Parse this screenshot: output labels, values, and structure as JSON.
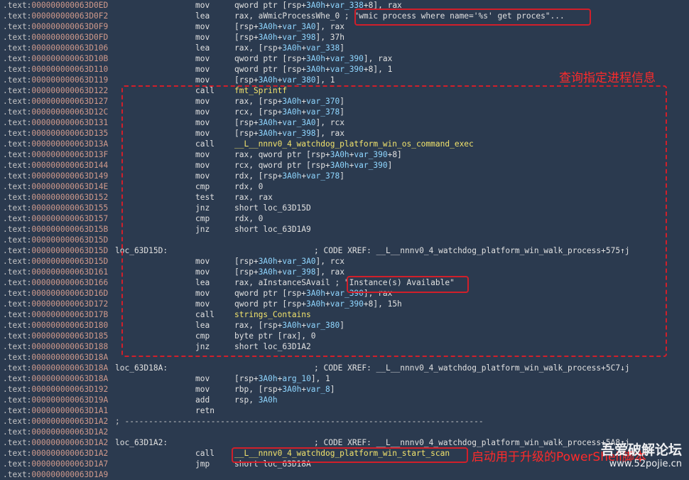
{
  "segment": ".text:",
  "rows": [
    {
      "addr": "000000000063D0ED",
      "label": "",
      "mnem": "mov",
      "ops": "qword ptr [rsp+3A0h+var_338+8], rax"
    },
    {
      "addr": "000000000063D0F2",
      "label": "",
      "mnem": "lea",
      "ops": "rax, aWmicProcessWhe_0 ; \"wmic process where name='%s' get proces\"..."
    },
    {
      "addr": "000000000063D0F9",
      "label": "",
      "mnem": "mov",
      "ops": "[rsp+3A0h+var_3A0], rax"
    },
    {
      "addr": "000000000063D0FD",
      "label": "",
      "mnem": "mov",
      "ops": "[rsp+3A0h+var_398], 37h"
    },
    {
      "addr": "000000000063D106",
      "label": "",
      "mnem": "lea",
      "ops": "rax, [rsp+3A0h+var_338]"
    },
    {
      "addr": "000000000063D10B",
      "label": "",
      "mnem": "mov",
      "ops": "qword ptr [rsp+3A0h+var_390], rax"
    },
    {
      "addr": "000000000063D110",
      "label": "",
      "mnem": "mov",
      "ops": "qword ptr [rsp+3A0h+var_390+8], 1"
    },
    {
      "addr": "000000000063D119",
      "label": "",
      "mnem": "mov",
      "ops": "[rsp+3A0h+var_380], 1"
    },
    {
      "addr": "000000000063D122",
      "label": "",
      "mnem": "call",
      "ops": "fmt_Sprintf",
      "call": true
    },
    {
      "addr": "000000000063D127",
      "label": "",
      "mnem": "mov",
      "ops": "rax, [rsp+3A0h+var_370]"
    },
    {
      "addr": "000000000063D12C",
      "label": "",
      "mnem": "mov",
      "ops": "rcx, [rsp+3A0h+var_378]"
    },
    {
      "addr": "000000000063D131",
      "label": "",
      "mnem": "mov",
      "ops": "[rsp+3A0h+var_3A0], rcx"
    },
    {
      "addr": "000000000063D135",
      "label": "",
      "mnem": "mov",
      "ops": "[rsp+3A0h+var_398], rax"
    },
    {
      "addr": "000000000063D13A",
      "label": "",
      "mnem": "call",
      "ops": "__L__nnnv0_4_watchdog_platform_win_os_command_exec",
      "call": true
    },
    {
      "addr": "000000000063D13F",
      "label": "",
      "mnem": "mov",
      "ops": "rax, qword ptr [rsp+3A0h+var_390+8]"
    },
    {
      "addr": "000000000063D144",
      "label": "",
      "mnem": "mov",
      "ops": "rcx, qword ptr [rsp+3A0h+var_390]"
    },
    {
      "addr": "000000000063D149",
      "label": "",
      "mnem": "mov",
      "ops": "rdx, [rsp+3A0h+var_378]"
    },
    {
      "addr": "000000000063D14E",
      "label": "",
      "mnem": "cmp",
      "ops": "rdx, 0"
    },
    {
      "addr": "000000000063D152",
      "label": "",
      "mnem": "test",
      "ops": "rax, rax"
    },
    {
      "addr": "000000000063D155",
      "label": "",
      "mnem": "jnz",
      "ops": "short loc_63D15D"
    },
    {
      "addr": "000000000063D157",
      "label": "",
      "mnem": "cmp",
      "ops": "rdx, 0"
    },
    {
      "addr": "000000000063D15B",
      "label": "",
      "mnem": "jnz",
      "ops": "short loc_63D1A9"
    },
    {
      "addr": "000000000063D15D",
      "label": "",
      "mnem": "",
      "ops": ""
    },
    {
      "addr": "000000000063D15D",
      "label": "loc_63D15D:",
      "mnem": "",
      "ops": "",
      "xref": "; CODE XREF: __L__nnnv0_4_watchdog_platform_win_walk_process+575↑j"
    },
    {
      "addr": "000000000063D15D",
      "label": "",
      "mnem": "mov",
      "ops": "[rsp+3A0h+var_3A0], rcx"
    },
    {
      "addr": "000000000063D161",
      "label": "",
      "mnem": "mov",
      "ops": "[rsp+3A0h+var_398], rax"
    },
    {
      "addr": "000000000063D166",
      "label": "",
      "mnem": "lea",
      "ops": "rax, aInstanceSAvail ; \"Instance(s) Available\""
    },
    {
      "addr": "000000000063D16D",
      "label": "",
      "mnem": "mov",
      "ops": "qword ptr [rsp+3A0h+var_390], rax"
    },
    {
      "addr": "000000000063D172",
      "label": "",
      "mnem": "mov",
      "ops": "qword ptr [rsp+3A0h+var_390+8], 15h"
    },
    {
      "addr": "000000000063D17B",
      "label": "",
      "mnem": "call",
      "ops": "strings_Contains",
      "call": true
    },
    {
      "addr": "000000000063D180",
      "label": "",
      "mnem": "lea",
      "ops": "rax, [rsp+3A0h+var_380]"
    },
    {
      "addr": "000000000063D185",
      "label": "",
      "mnem": "cmp",
      "ops": "byte ptr [rax], 0"
    },
    {
      "addr": "000000000063D188",
      "label": "",
      "mnem": "jnz",
      "ops": "short loc_63D1A2"
    },
    {
      "addr": "000000000063D18A",
      "label": "",
      "mnem": "",
      "ops": ""
    },
    {
      "addr": "000000000063D18A",
      "label": "loc_63D18A:",
      "mnem": "",
      "ops": "",
      "xref": "; CODE XREF: __L__nnnv0_4_watchdog_platform_win_walk_process+5C7↓j"
    },
    {
      "addr": "000000000063D18A",
      "label": "",
      "mnem": "mov",
      "ops": "[rsp+3A0h+arg_10], 1"
    },
    {
      "addr": "000000000063D192",
      "label": "",
      "mnem": "mov",
      "ops": "rbp, [rsp+3A0h+var_8]"
    },
    {
      "addr": "000000000063D19A",
      "label": "",
      "mnem": "add",
      "ops": "rsp, 3A0h"
    },
    {
      "addr": "000000000063D1A1",
      "label": "",
      "mnem": "retn",
      "ops": ""
    },
    {
      "addr": "000000000063D1A2",
      "label": "; ---------------------------------------------------------------------------",
      "mnem": "",
      "ops": ""
    },
    {
      "addr": "000000000063D1A2",
      "label": "",
      "mnem": "",
      "ops": ""
    },
    {
      "addr": "000000000063D1A2",
      "label": "loc_63D1A2:",
      "mnem": "",
      "ops": "",
      "xref": "; CODE XREF: __L__nnnv0_4_watchdog_platform_win_walk_process+5A8↑j"
    },
    {
      "addr": "000000000063D1A2",
      "label": "",
      "mnem": "call",
      "ops": "__L__nnnv0_4_watchdog_platform_win_start_scan",
      "call": true
    },
    {
      "addr": "000000000063D1A7",
      "label": "",
      "mnem": "jmp",
      "ops": "short loc_63D18A"
    },
    {
      "addr": "000000000063D1A9",
      "label": "",
      "mnem": "",
      "ops": ""
    }
  ],
  "annotations": {
    "query_process": "查询指定进程信息",
    "launch_powershell": "启动用于升级的PowerShell脚本"
  },
  "watermark": {
    "line1": "吾爱破解论坛",
    "line2": "www.52pojie.cn"
  },
  "colors": {
    "background": "#2b3a4f",
    "annotation_red": "#d11f2a",
    "call_target_yellow": "#f2e36c",
    "var_blue": "#8fd6ff"
  }
}
